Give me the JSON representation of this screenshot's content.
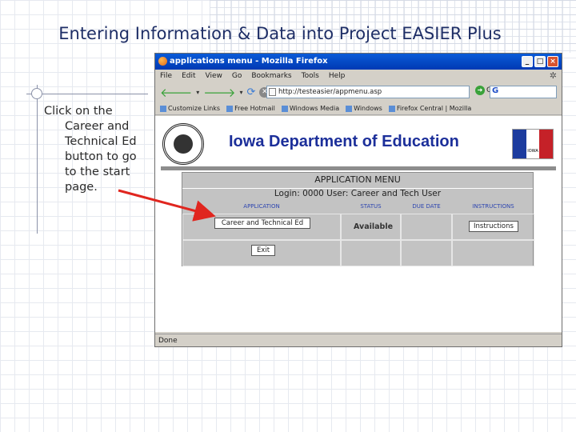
{
  "slide": {
    "title": "Entering Information & Data into Project EASIER Plus",
    "bullet_line1": "Click on the",
    "bullet_lines": [
      "Career and",
      "Technical Ed",
      "button to go",
      "to the start",
      "page."
    ]
  },
  "browser": {
    "window_title": "applications menu - Mozilla Firefox",
    "win_buttons": [
      "_",
      "□",
      "×"
    ],
    "menu": [
      "File",
      "Edit",
      "View",
      "Go",
      "Bookmarks",
      "Tools",
      "Help"
    ],
    "url": "http://testeasier/appmenu.asp",
    "go_label": "Go",
    "search_icon": "G",
    "bookmarks": [
      "Customize Links",
      "Free Hotmail",
      "Windows Media",
      "Windows",
      "Firefox Central | Mozilla"
    ],
    "status": "Done"
  },
  "page": {
    "heading": "Iowa Department of Education",
    "flag_label": "IOWA",
    "menu_title": "APPLICATION MENU",
    "login_line": "Login: 0000    User: Career and Tech User",
    "columns": [
      "APPLICATION",
      "STATUS",
      "DUE DATE",
      "INSTRUCTIONS"
    ],
    "app_button": "Career and Technical Ed",
    "status_value": "Available",
    "instructions_button": "Instructions",
    "exit_button": "Exit"
  },
  "colors": {
    "title": "#1e2e66",
    "iowa_heading": "#1c2f9a",
    "arrow": "#e0261f"
  }
}
